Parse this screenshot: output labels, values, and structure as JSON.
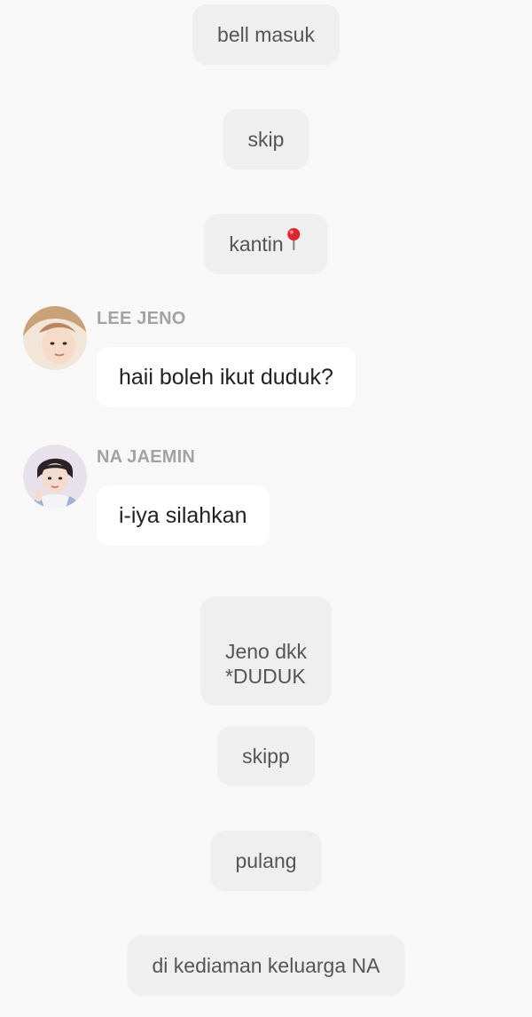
{
  "messages": {
    "sys_bell_masuk": "bell masuk",
    "sys_skip": "skip",
    "sys_kantin": "kantin",
    "jeno": {
      "sender": "LEE JENO",
      "text": "haii boleh ikut duduk?"
    },
    "jaemin": {
      "sender": "NA JAEMIN",
      "text": "i-iya silahkan"
    },
    "sys_jeno_duduk": "Jeno dkk\n*DUDUK",
    "sys_skipp": "skipp",
    "sys_pulang": "pulang",
    "sys_kediaman": "di kediaman keluarga NA"
  },
  "icons": {
    "kantin_emoji": "round-pushpin-icon"
  },
  "colors": {
    "background": "#f8f8f8",
    "system_bubble": "#efefef",
    "chat_bubble": "#ffffff",
    "sender_name": "#a3a3a3",
    "pin": "#e0242e"
  }
}
